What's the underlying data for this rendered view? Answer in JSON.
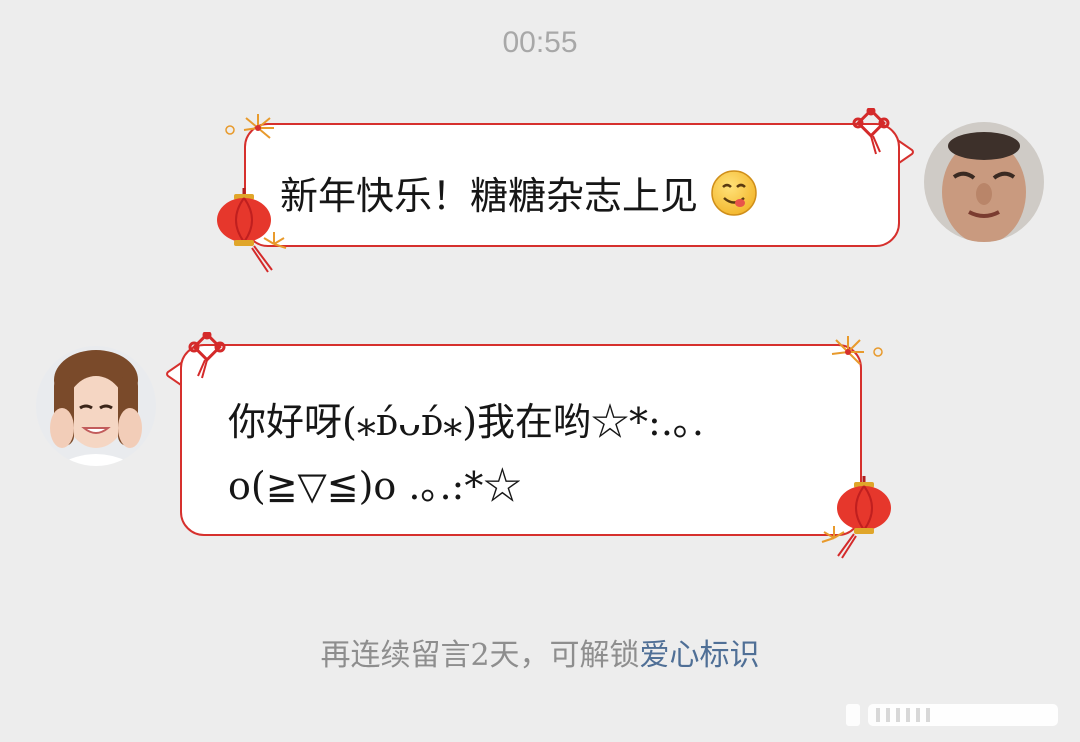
{
  "chat": {
    "timestamp": "00:55",
    "messages": [
      {
        "side": "right",
        "text": "新年快乐！糖糖杂志上见",
        "emoji": "yum-face-emoji"
      },
      {
        "side": "left",
        "line1": "你好呀(⁎ᴅ́ᴗᴅ́⁎)我在哟☆*:.｡.",
        "line2": "o(≧▽≦)o .｡.:*☆"
      }
    ]
  },
  "notice": {
    "prefix": "再连续留言2天，可解锁",
    "link": "爱心标识"
  },
  "colors": {
    "background": "#ededed",
    "bubble_border": "#d6302d",
    "link": "#4f6f96",
    "lantern": "#e6372c",
    "knot": "#d42a2a"
  }
}
